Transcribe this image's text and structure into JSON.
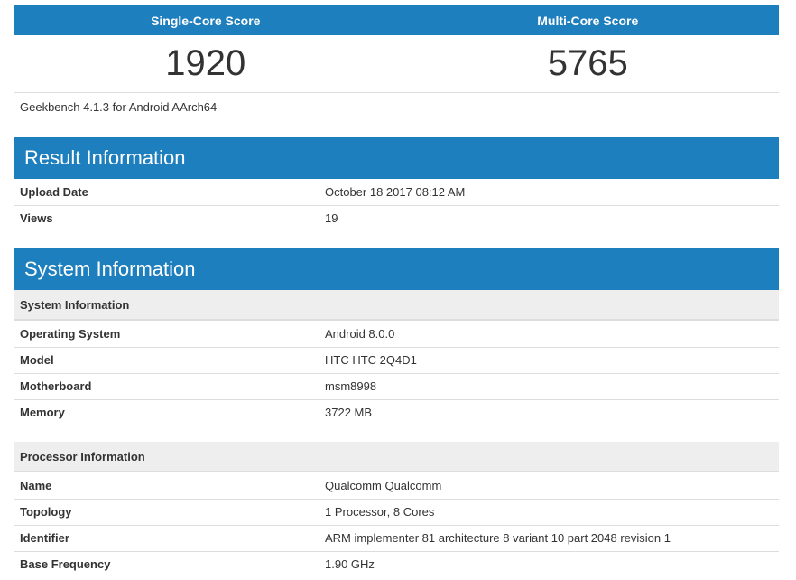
{
  "scores": {
    "single_label": "Single-Core Score",
    "multi_label": "Multi-Core Score",
    "single_value": "1920",
    "multi_value": "5765"
  },
  "version": "Geekbench 4.1.3 for Android AArch64",
  "result_info": {
    "title": "Result Information",
    "rows": [
      {
        "key": "Upload Date",
        "value": "October 18 2017 08:12 AM"
      },
      {
        "key": "Views",
        "value": "19"
      }
    ]
  },
  "system_info": {
    "title": "System Information",
    "system_subhead": "System Information",
    "system_rows": [
      {
        "key": "Operating System",
        "value": "Android 8.0.0"
      },
      {
        "key": "Model",
        "value": "HTC HTC 2Q4D1"
      },
      {
        "key": "Motherboard",
        "value": "msm8998"
      },
      {
        "key": "Memory",
        "value": "3722 MB"
      }
    ],
    "processor_subhead": "Processor Information",
    "processor_rows": [
      {
        "key": "Name",
        "value": "Qualcomm Qualcomm"
      },
      {
        "key": "Topology",
        "value": "1 Processor, 8 Cores"
      },
      {
        "key": "Identifier",
        "value": "ARM implementer 81 architecture 8 variant 10 part 2048 revision 1"
      },
      {
        "key": "Base Frequency",
        "value": "1.90 GHz"
      }
    ]
  },
  "colors": {
    "accent": "#1d7fbd",
    "subhead_bg": "#eeeeee"
  }
}
